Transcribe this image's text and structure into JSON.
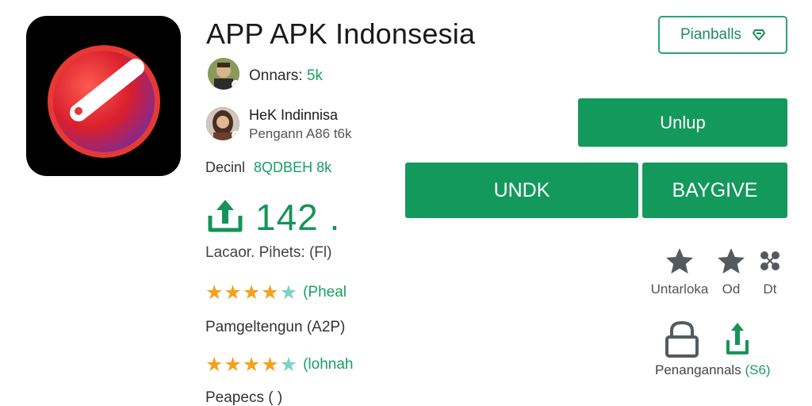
{
  "app": {
    "title": "APP APK Indonsesia",
    "icon_name": "app-logo-icon"
  },
  "owner": {
    "label": "Onnars:",
    "value": "5k"
  },
  "developer": {
    "name": "HeK Indinnisa",
    "subtitle": "Pengann A86 t6k"
  },
  "decimal": {
    "label": "Decinl",
    "value": "8QDBEH 8k"
  },
  "downloads": {
    "count": "142 .",
    "label": "Lacaor. Pihets: (Fl)"
  },
  "ratings": [
    {
      "stars": 4,
      "stars_total": 5,
      "label": "(Pheal"
    },
    {
      "stars": 4,
      "stars_total": 5,
      "label": "(lohnah"
    }
  ],
  "meta": {
    "line1": "Pamgeltengun (A2P)",
    "line2": "Peapecs ( )"
  },
  "buttons": {
    "outline_label": "Pianballs",
    "unlup_label": "Unlup",
    "undk_label": "UNDK",
    "baygive_label": "BAYGIVE"
  },
  "actions": [
    {
      "label": "Untarloka",
      "icon": "star-icon"
    },
    {
      "label": "Od",
      "icon": "star-icon"
    },
    {
      "label": "Dt",
      "icon": "share-icon"
    }
  ],
  "bottom": {
    "label": "Penangannals",
    "value": "(S6)",
    "icons": [
      "lock-icon",
      "share-icon"
    ]
  },
  "colors": {
    "green": "#13995c",
    "accent_text": "#19a061",
    "star": "#f4a11d",
    "star_partial": "#7dd3c0"
  }
}
